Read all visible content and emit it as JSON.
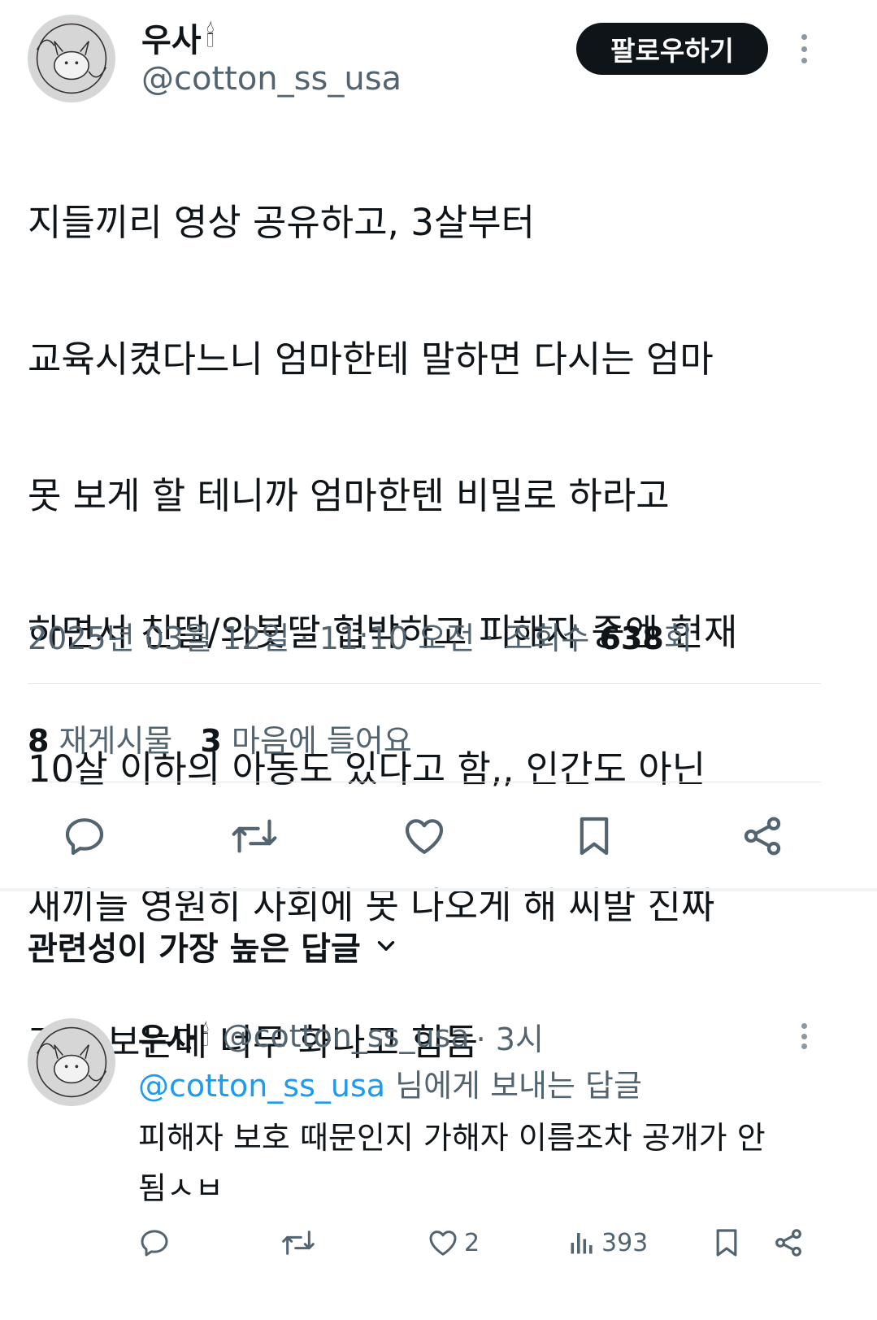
{
  "tweet": {
    "author_name": "우사",
    "author_emoji": "🕯",
    "author_handle": "@cotton_ss_usa",
    "follow_label": "팔로우하기",
    "text_lines": [
      "지들끼리 영상 공유하고, 3살부터",
      "교육시켰다느니 엄마한테 말하면 다시는 엄마",
      "못 보게 할 테니까 엄마한텐 비밀로 하라고",
      "하면서 친딸/의붓딸 협박하고 피해자 중엔 현재",
      "10살 이하의 아동도 있다고 함,, 인간도 아닌",
      "새끼들 영원히 사회에 못 나오게 해 씨발 진짜",
      "기사 보는데 너무 화나고 힘듬"
    ],
    "timestamp": "2025년 03월 12일 · 11:10 오전 · 조회수 ",
    "views_count": "638",
    "views_suffix": "회",
    "reposts_count": "8",
    "reposts_label": " 재게시물",
    "likes_count": "3",
    "likes_label": " 마음에 들어요"
  },
  "actions": {
    "reply": "reply-icon",
    "repost": "repost-icon",
    "like": "heart-icon",
    "bookmark": "bookmark-icon",
    "share": "share-icon"
  },
  "replies_section": {
    "title": "관련성이 가장 높은 답글"
  },
  "reply": {
    "author_name": "우사",
    "author_emoji": "🕯",
    "author_handle": "@cotton_ss_usa",
    "time": " · 3시",
    "reply_to_handle": "@cotton_ss_usa",
    "reply_to_suffix": " 님에게 보내는 답글",
    "text": "피해자 보호 때문인지 가해자 이름조차 공개가 안\n됨ㅅㅂ",
    "likes": "2",
    "views": "393"
  },
  "colors": {
    "accent": "#1d9bf0",
    "text": "#0f1419",
    "secondary": "#536471"
  }
}
